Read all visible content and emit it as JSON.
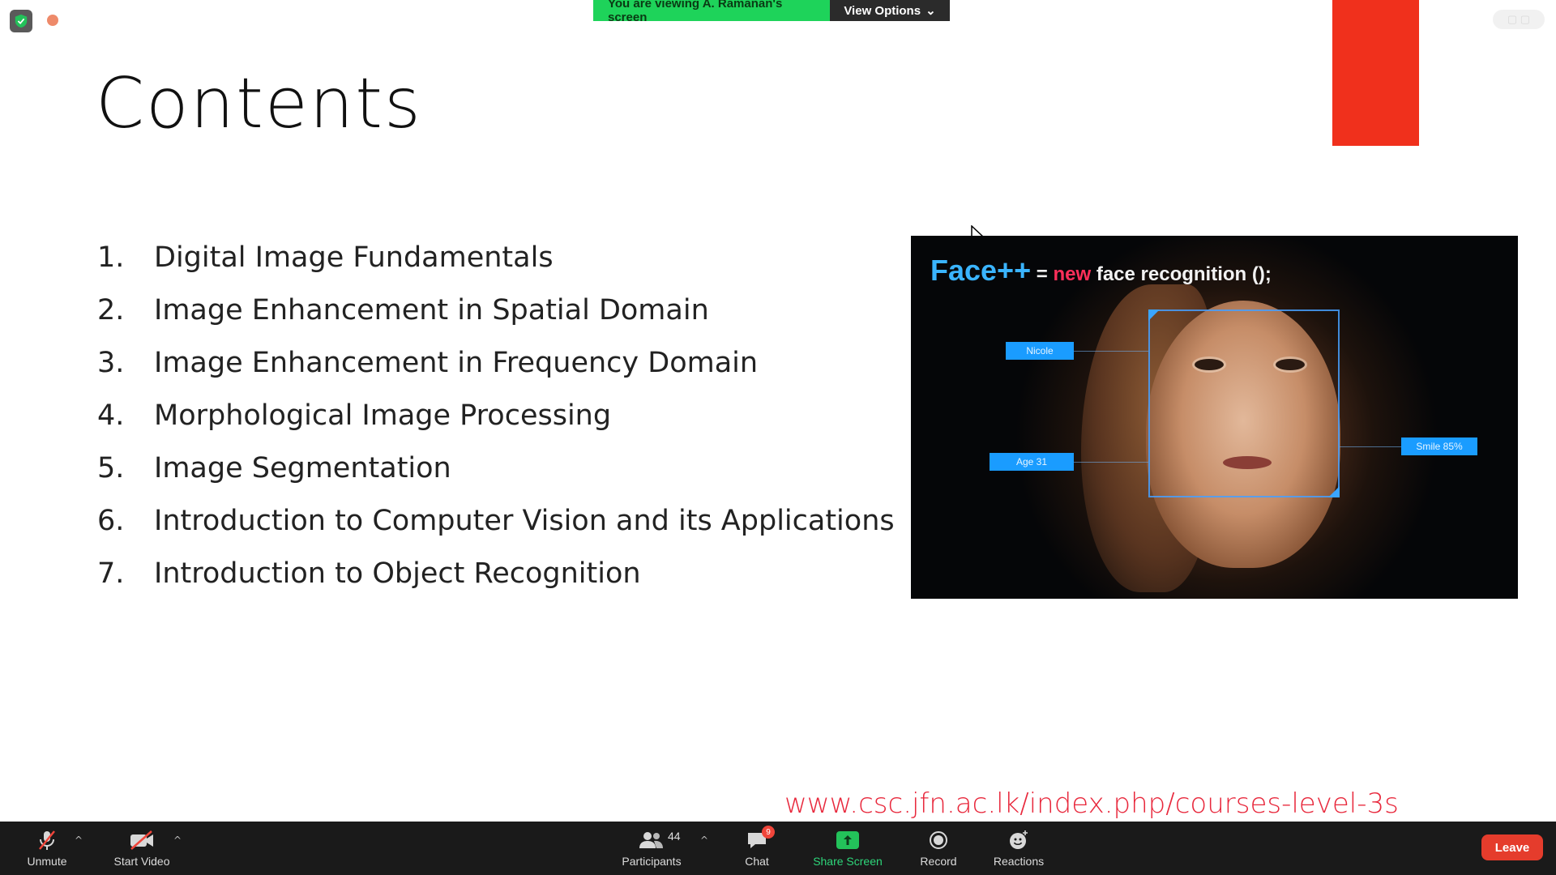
{
  "banner": {
    "viewing_text": "You are viewing A. Ramanan's screen",
    "view_options_label": "View Options"
  },
  "slide": {
    "title": "Contents",
    "items": [
      {
        "number": "1.",
        "text": "Digital Image Fundamentals"
      },
      {
        "number": "2.",
        "text": "Image Enhancement in Spatial Domain"
      },
      {
        "number": "3.",
        "text": "Image Enhancement in Frequency Domain"
      },
      {
        "number": "4.",
        "text": "Morphological Image Processing"
      },
      {
        "number": "5.",
        "text": "Image Segmentation"
      },
      {
        "number": "6.",
        "text": "Introduction to Computer Vision and its Applications"
      },
      {
        "number": "7.",
        "text": "Introduction to Object Recognition"
      }
    ],
    "image": {
      "code_face": "Face++",
      "code_eq": " = ",
      "code_new": "new",
      "code_rest": " face recognition ();",
      "tag_name": "Nicole",
      "tag_age": "Age 31",
      "tag_smile": "Smile 85%"
    },
    "url": "www.csc.jfn.ac.lk/index.php/courses-level-3s"
  },
  "toolbar": {
    "unmute_label": "Unmute",
    "start_video_label": "Start Video",
    "participants_label": "Participants",
    "participants_count": "44",
    "chat_label": "Chat",
    "chat_badge": "9",
    "share_screen_label": "Share Screen",
    "record_label": "Record",
    "reactions_label": "Reactions",
    "leave_label": "Leave"
  },
  "colors": {
    "accent_red": "#f0301c",
    "banner_green": "#1ed35a",
    "url_red": "#e8283c",
    "share_green": "#2ed67a"
  }
}
